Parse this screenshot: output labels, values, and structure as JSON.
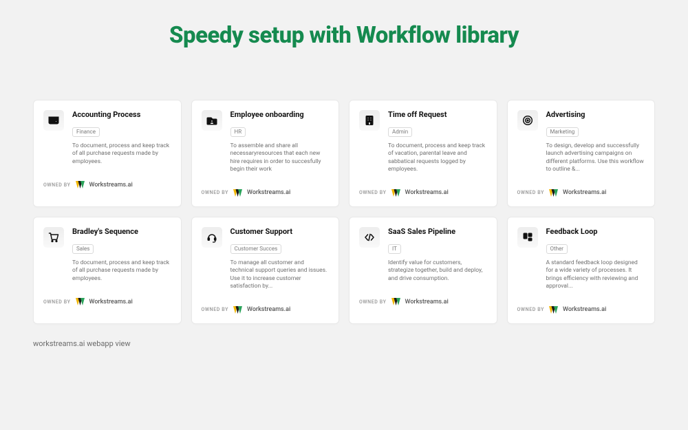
{
  "heading": "Speedy setup with Workflow library",
  "owned_by_label": "OWNED BY",
  "owner_name": "Workstreams.ai",
  "caption": "workstreams.ai webapp view",
  "cards": [
    {
      "title": "Accounting Process",
      "tag": "Finance",
      "desc": "To document, process and keep track of all purchase requests made by employees."
    },
    {
      "title": "Employee onboarding",
      "tag": "HR",
      "desc": "To assemble and share all necessaryresources that each new hire requires in order to succesfully begin their work"
    },
    {
      "title": "Time off Request",
      "tag": "Admin",
      "desc": "To document, process and keep track of vacation, parental leave and sabbatical requests logged by employees."
    },
    {
      "title": "Advertising",
      "tag": "Marketing",
      "desc": "To design, develop and successfully launch advertising campaigns on different platforms. Use this workflow to outline &..."
    },
    {
      "title": "Bradley's Sequence",
      "tag": "Sales",
      "desc": "To document, process and keep track of all purchase requests made by employees."
    },
    {
      "title": "Customer Support",
      "tag": "Customer Succes",
      "desc": "To manage all customer and technical support queries and issues. Use it to increase customer satisfaction by..."
    },
    {
      "title": "SaaS Sales Pipeline",
      "tag": "IT",
      "desc": "Identify value for customers, strategize together, build and deploy, and drive consumption."
    },
    {
      "title": "Feedback Loop",
      "tag": "Other",
      "desc": "A standard feedback loop designed for a wide variety of processes. It brings efficiency with reviewing and approval..."
    }
  ]
}
